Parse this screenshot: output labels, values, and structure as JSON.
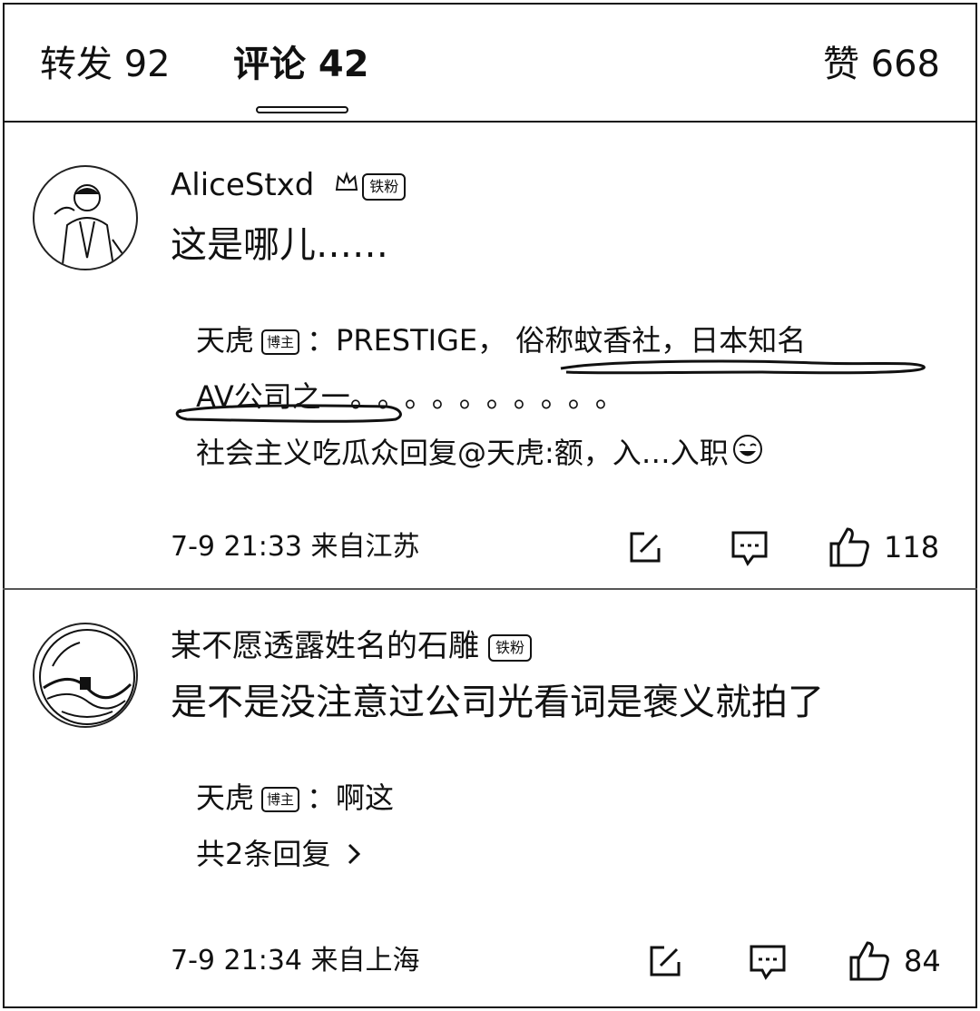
{
  "tabs": {
    "repost": "转发 92",
    "comments": "评论 42",
    "likes": "赞 668"
  },
  "comments": [
    {
      "username": "AliceStxd",
      "badge": "铁粉",
      "text": "这是哪儿……",
      "replies": [
        {
          "author": "天虎",
          "author_badge": "博主",
          "sep": "：",
          "text_before": "PRESTIGE，",
          "text_highlight_1": "俗称蚊香社，日本知名",
          "text_highlight_2": "AV公司之一",
          "text_after": "。。。。。。。。。。"
        }
      ],
      "summary_reply": "社会主义吃瓜众回复@天虎:额，入…入职",
      "time": "7-9 21:33",
      "location": "来自江苏",
      "likes": "118"
    },
    {
      "username": "某不愿透露姓名的石雕",
      "badge": "铁粉",
      "text": "是不是没注意过公司光看词是褒义就拍了",
      "replies": [
        {
          "author": "天虎",
          "author_badge": "博主",
          "sep": "：",
          "text": "啊这"
        }
      ],
      "more_replies": "共2条回复",
      "time": "7-9 21:34",
      "location": "来自上海",
      "likes": "84"
    }
  ],
  "icons": {
    "repost": "edit-icon",
    "comment": "comment-icon",
    "like": "thumbs-up-icon",
    "laugh": "laugh-emoji-icon",
    "chevron": "chevron-right-icon"
  }
}
